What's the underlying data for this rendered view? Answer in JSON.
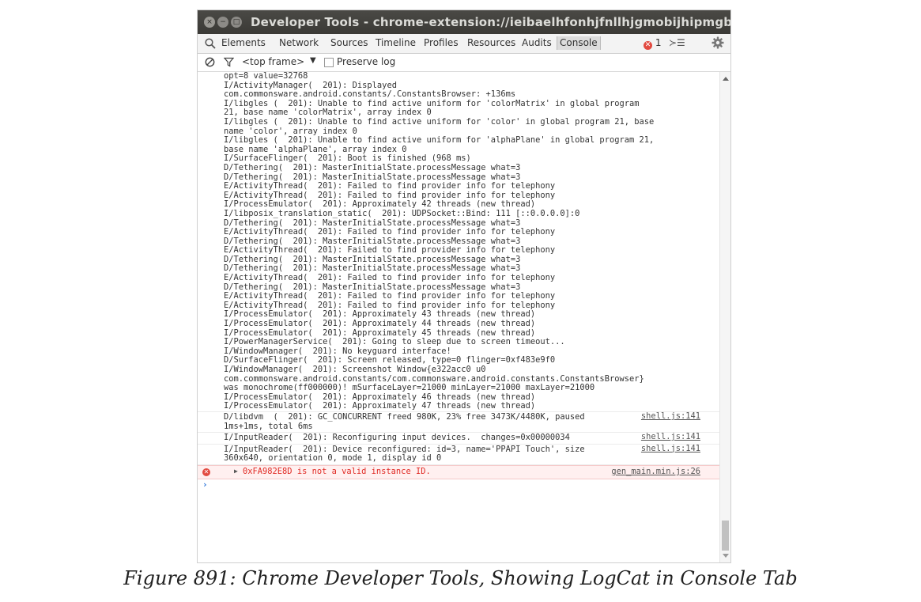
{
  "window": {
    "title": "Developer Tools - chrome-extension://ieibaelhfonhjfnllhjgmobijhipmgbc/_mod",
    "buttons": {
      "close": "×",
      "minimize": "−",
      "maximize": "□"
    }
  },
  "tabs": [
    {
      "label": "Elements"
    },
    {
      "label": "Network"
    },
    {
      "label": "Sources"
    },
    {
      "label": "Timeline"
    },
    {
      "label": "Profiles"
    },
    {
      "label": "Resources"
    },
    {
      "label": "Audits"
    },
    {
      "label": "Console"
    }
  ],
  "toolbar": {
    "error_badge_icon": "✕",
    "error_count": "1",
    "drawer_icon": "≻☰"
  },
  "filter": {
    "context": "<top frame>",
    "context_arrow": "▼",
    "preserve_log": "Preserve log"
  },
  "console": {
    "block_lines": [
      "opt=8 value=32768",
      "I/ActivityManager(  201): Displayed",
      "com.commonsware.android.constants/.ConstantsBrowser: +136ms",
      "I/libgles (  201): Unable to find active uniform for 'colorMatrix' in global program",
      "21, base name 'colorMatrix', array index 0",
      "I/libgles (  201): Unable to find active uniform for 'color' in global program 21, base",
      "name 'color', array index 0",
      "I/libgles (  201): Unable to find active uniform for 'alphaPlane' in global program 21,",
      "base name 'alphaPlane', array index 0",
      "I/SurfaceFlinger(  201): Boot is finished (968 ms)",
      "D/Tethering(  201): MasterInitialState.processMessage what=3",
      "D/Tethering(  201): MasterInitialState.processMessage what=3",
      "E/ActivityThread(  201): Failed to find provider info for telephony",
      "E/ActivityThread(  201): Failed to find provider info for telephony",
      "I/ProcessEmulator(  201): Approximately 42 threads (new thread)",
      "I/libposix_translation_static(  201): UDPSocket::Bind: 111 [::0.0.0.0]:0",
      "D/Tethering(  201): MasterInitialState.processMessage what=3",
      "E/ActivityThread(  201): Failed to find provider info for telephony",
      "D/Tethering(  201): MasterInitialState.processMessage what=3",
      "E/ActivityThread(  201): Failed to find provider info for telephony",
      "D/Tethering(  201): MasterInitialState.processMessage what=3",
      "D/Tethering(  201): MasterInitialState.processMessage what=3",
      "E/ActivityThread(  201): Failed to find provider info for telephony",
      "D/Tethering(  201): MasterInitialState.processMessage what=3",
      "E/ActivityThread(  201): Failed to find provider info for telephony",
      "E/ActivityThread(  201): Failed to find provider info for telephony",
      "I/ProcessEmulator(  201): Approximately 43 threads (new thread)",
      "I/ProcessEmulator(  201): Approximately 44 threads (new thread)",
      "I/ProcessEmulator(  201): Approximately 45 threads (new thread)",
      "I/PowerManagerService(  201): Going to sleep due to screen timeout...",
      "I/WindowManager(  201): No keyguard interface!",
      "D/SurfaceFlinger(  201): Screen released, type=0 flinger=0xf483e9f0",
      "I/WindowManager(  201): Screenshot Window{e322acc0 u0",
      "com.commonsware.android.constants/com.commonsware.android.constants.ConstantsBrowser}",
      "was monochrome(ff000000)! mSurfaceLayer=21000 minLayer=21000 maxLayer=21000",
      "I/ProcessEmulator(  201): Approximately 46 threads (new thread)",
      "I/ProcessEmulator(  201): Approximately 47 threads (new thread)"
    ],
    "messages": [
      {
        "lines": [
          "D/libdvm  (  201): GC_CONCURRENT freed 980K, 23% free 3473K/4480K, paused",
          "1ms+1ms, total 6ms"
        ],
        "source": "shell.js:141"
      },
      {
        "lines": [
          "I/InputReader(  201): Reconfiguring input devices.  changes=0x00000034"
        ],
        "source": "shell.js:141"
      },
      {
        "lines": [
          "I/InputReader(  201): Device reconfigured: id=3, name='PPAPI Touch', size",
          "360x640, orientation 0, mode 1, display id 0"
        ],
        "source": "shell.js:141"
      }
    ],
    "error": {
      "icon": "✕",
      "caret": "▶",
      "text": "0xFA982E8D is not a valid instance ID.",
      "source": "gen_main.min.js:26"
    },
    "prompt": "›"
  },
  "caption": "Figure 891: Chrome Developer Tools, Showing LogCat in Console Tab"
}
